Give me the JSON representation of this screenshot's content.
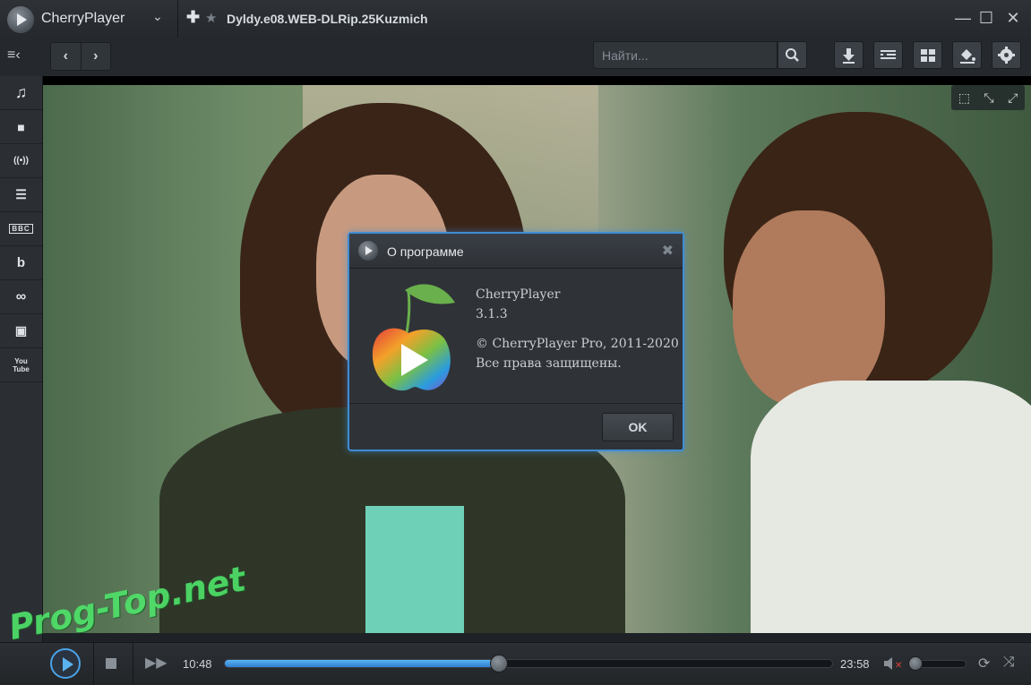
{
  "app": {
    "name": "CherryPlayer",
    "menu_glyph": "⌄"
  },
  "tab": {
    "add_glyph": "✚",
    "star_glyph": "★",
    "title": "Dyldy.e08.WEB-DLRip.25Kuzmich"
  },
  "window_buttons": {
    "minimize": "—",
    "maximize": "☐",
    "close": "✕"
  },
  "toolbar": {
    "menu_glyph": "≡‹",
    "back": "‹",
    "forward": "›",
    "search_placeholder": "Найти...",
    "icons": [
      "search-icon",
      "download-icon",
      "playlist-icon",
      "grid-icon",
      "paint-bucket-icon",
      "gear-icon"
    ]
  },
  "sidebar": {
    "items": [
      {
        "icon": "music-icon",
        "glyph": "♫"
      },
      {
        "icon": "video-camera-icon",
        "glyph": "■"
      },
      {
        "icon": "radio-icon",
        "glyph": "((•))"
      },
      {
        "icon": "tv-list-icon",
        "glyph": "☰"
      },
      {
        "icon": "bbc-icon",
        "glyph": "BBC"
      },
      {
        "icon": "bandcamp-icon",
        "glyph": "b"
      },
      {
        "icon": "lastfm-icon",
        "glyph": "∞"
      },
      {
        "icon": "twitch-icon",
        "glyph": "▣"
      },
      {
        "icon": "youtube-icon",
        "glyph": "You\nTube"
      }
    ]
  },
  "video_corner": {
    "icons": [
      "crop-icon",
      "shrink-icon",
      "fullscreen-icon"
    ],
    "glyphs": [
      "⬚",
      "⤡",
      "⤢"
    ]
  },
  "dialog": {
    "title": "О программе",
    "close_glyph": "✖",
    "product": "CherryPlayer",
    "version": "3.1.3",
    "copyright": "© CherryPlayer Pro, 2011-2020",
    "rights": "Все права защищены.",
    "ok_label": "OK"
  },
  "playback": {
    "current_time": "10:48",
    "total_time": "23:58",
    "progress_fraction": 0.45,
    "volume_fraction": 0.0,
    "muted": true,
    "stop_glyph": "",
    "ff_glyph": "▶▶",
    "mute_glyph": "◀✕",
    "repeat_glyph": "⟳",
    "shuffle_glyph": "⤨"
  },
  "watermark": "Prog-Top.net",
  "colors": {
    "accent": "#3e8cd6",
    "progress": "#4aa3e8",
    "watermark": "#4fe36a"
  }
}
